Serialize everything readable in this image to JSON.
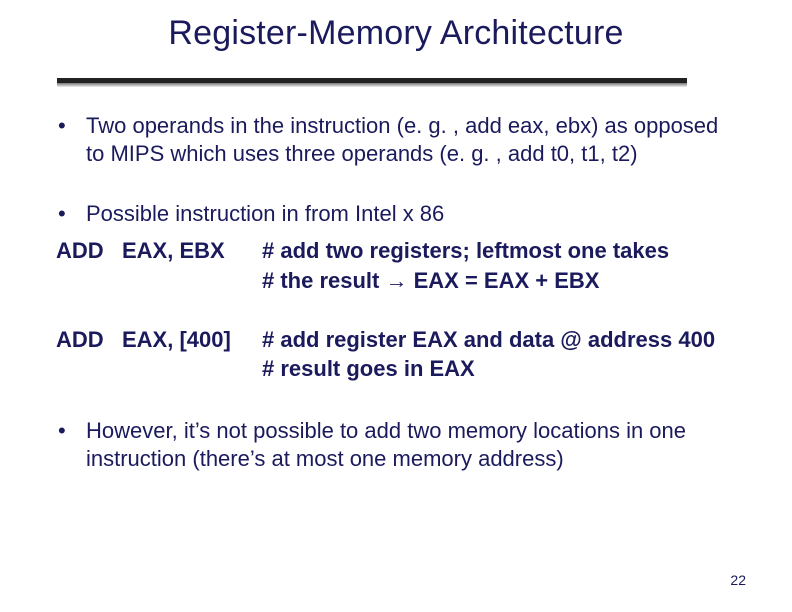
{
  "title": "Register-Memory Architecture",
  "bullets": {
    "b1": "Two operands in the instruction (e. g. , add eax, ebx) as opposed to MIPS which uses three operands (e. g. , add t0, t1, t2)",
    "b2": "Possible instruction in from Intel x 86",
    "b3": "However, it’s not possible to add two memory locations in one instruction (there’s at most one memory address)"
  },
  "code": {
    "row1_left": "ADD   EAX, EBX",
    "row1_right_line1": "# add two registers; leftmost one takes",
    "row1_right_line2_pre": "# the result ",
    "row1_right_line2_post": " EAX = EAX + EBX",
    "row2_left": "ADD   EAX, [400]",
    "row2_right_line1": "# add register EAX and data @ address 400",
    "row2_right_line2": "# result goes in EAX"
  },
  "icons": {
    "arrow": "→"
  },
  "page_number": "22"
}
